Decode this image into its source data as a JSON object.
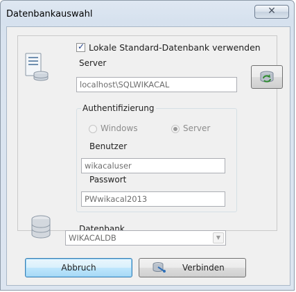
{
  "window": {
    "title": "Datenbankauswahl",
    "close_glyph": "✕"
  },
  "icons": {
    "server": "server-icon",
    "refresh": "refresh-icon",
    "database": "database-icon",
    "connect": "connect-icon"
  },
  "local_db": {
    "checked": true,
    "label": "Lokale Standard-Datenbank verwenden"
  },
  "server": {
    "label": "Server",
    "value": "localhost\\SQLWIKACAL"
  },
  "auth": {
    "legend": "Authentifizierung",
    "options": [
      "Windows",
      "Server"
    ],
    "selected": "Server",
    "user_label": "Benutzer",
    "user_value": "wikacaluser",
    "password_label": "Passwort",
    "password_value": "PWwikacal2013"
  },
  "database": {
    "label": "Datenbank",
    "value": "WIKACALDB"
  },
  "buttons": {
    "cancel": "Abbruch",
    "connect": "Verbinden"
  },
  "colors": {
    "accent_button_border": "#3c7fb1",
    "window_frame": "#d6e1ee"
  }
}
